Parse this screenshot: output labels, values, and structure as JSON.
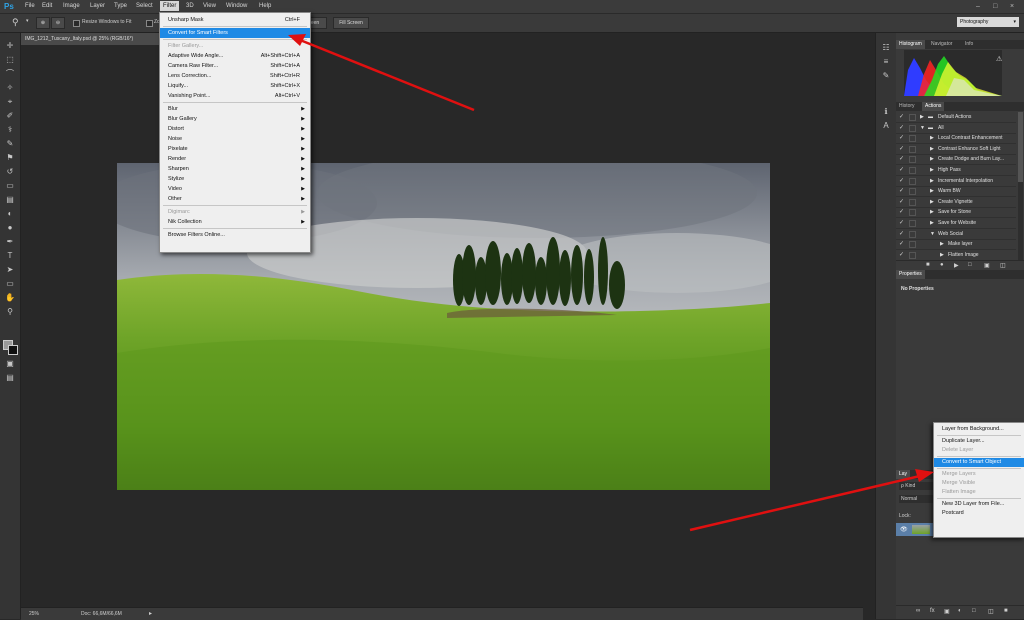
{
  "app": {
    "logo": "Ps"
  },
  "menubar": {
    "items": [
      "File",
      "Edit",
      "Image",
      "Layer",
      "Type",
      "Select",
      "Filter",
      "3D",
      "View",
      "Window",
      "Help"
    ],
    "active": "Filter"
  },
  "options": {
    "resize_label": "Resize Windows to Fit",
    "zoom_partial": "Zo",
    "fill_screen": "Fill Screen",
    "screen_partial": "een",
    "workspace": "Photography"
  },
  "document": {
    "tab_title": "IMG_1212_Tuscany_Italy.psd @ 25% (RGB/16*)",
    "zoom": "25%",
    "doc_info": "Doc: 66,6M/66,6M"
  },
  "filter_menu": [
    {
      "label": "Unsharp Mask",
      "shortcut": "Ctrl+F"
    },
    {
      "sep": true
    },
    {
      "label": "Convert for Smart Filters",
      "highlighted": true
    },
    {
      "sep": true
    },
    {
      "label": "Filter Gallery...",
      "disabled": true
    },
    {
      "label": "Adaptive Wide Angle...",
      "shortcut": "Alt+Shift+Ctrl+A"
    },
    {
      "label": "Camera Raw Filter...",
      "shortcut": "Shift+Ctrl+A"
    },
    {
      "label": "Lens Correction...",
      "shortcut": "Shift+Ctrl+R"
    },
    {
      "label": "Liquify...",
      "shortcut": "Shift+Ctrl+X"
    },
    {
      "label": "Vanishing Point...",
      "shortcut": "Alt+Ctrl+V"
    },
    {
      "sep": true
    },
    {
      "label": "Blur",
      "sub": true
    },
    {
      "label": "Blur Gallery",
      "sub": true
    },
    {
      "label": "Distort",
      "sub": true
    },
    {
      "label": "Noise",
      "sub": true
    },
    {
      "label": "Pixelate",
      "sub": true
    },
    {
      "label": "Render",
      "sub": true
    },
    {
      "label": "Sharpen",
      "sub": true
    },
    {
      "label": "Stylize",
      "sub": true
    },
    {
      "label": "Video",
      "sub": true
    },
    {
      "label": "Other",
      "sub": true
    },
    {
      "sep": true
    },
    {
      "label": "Digimarc",
      "sub": true,
      "disabled": true
    },
    {
      "label": "Nik Collection",
      "sub": true
    },
    {
      "sep": true
    },
    {
      "label": "Browse Filters Online..."
    }
  ],
  "panels": {
    "top_tabs": [
      "Histogram",
      "Navigator",
      "Info"
    ],
    "mid_tabs": [
      "History",
      "Actions"
    ],
    "properties_tab": "Properties",
    "no_properties": "No Properties",
    "layers_tab_partial": "Lay",
    "kind_partial": "ρ Kind",
    "blend_partial": "Normal",
    "lock_label": "Lock:"
  },
  "actions": [
    {
      "label": "Default Actions",
      "level": 0,
      "folder": true
    },
    {
      "label": "All",
      "level": 0,
      "folder": true,
      "open": true
    },
    {
      "label": "Local Contrast Enhancement",
      "level": 1
    },
    {
      "label": "Contrast Enhance Soft Light",
      "level": 1
    },
    {
      "label": "Create Dodge and Burn Lay...",
      "level": 1
    },
    {
      "label": "High Pass",
      "level": 1
    },
    {
      "label": "Incremental Interpolation",
      "level": 1
    },
    {
      "label": "Warm BW",
      "level": 1
    },
    {
      "label": "Create Vignette",
      "level": 1
    },
    {
      "label": "Save for Stone",
      "level": 1
    },
    {
      "label": "Save for Website",
      "level": 1
    },
    {
      "label": "Web Social",
      "level": 1,
      "open": true
    },
    {
      "label": "Make layer",
      "level": 2
    },
    {
      "label": "Flatten Image",
      "level": 2
    }
  ],
  "layer_menu": [
    {
      "label": "Layer from Background..."
    },
    {
      "sep": true
    },
    {
      "label": "Duplicate Layer..."
    },
    {
      "label": "Delete Layer",
      "disabled": true
    },
    {
      "sep": true
    },
    {
      "label": "Convert to Smart Object",
      "highlighted": true
    },
    {
      "sep": true
    },
    {
      "label": "Merge Layers",
      "disabled": true
    },
    {
      "label": "Merge Visible",
      "disabled": true
    },
    {
      "label": "Flatten Image",
      "disabled": true
    },
    {
      "sep": true
    },
    {
      "label": "New 3D Layer from File..."
    },
    {
      "label": "Postcard"
    }
  ],
  "colors": {
    "highlight": "#1f8ae5",
    "annotation_arrow": "#e01010",
    "ps_blue": "#2fa3e6"
  },
  "icons": {
    "tools": [
      "move-icon",
      "marquee-icon",
      "lasso-icon",
      "quick-select-icon",
      "crop-icon",
      "eyedropper-icon",
      "healing-icon",
      "brush-icon",
      "clone-stamp-icon",
      "history-brush-icon",
      "eraser-icon",
      "gradient-icon",
      "blur-icon",
      "dodge-icon",
      "pen-icon",
      "type-icon",
      "path-select-icon",
      "shape-icon",
      "hand-icon",
      "zoom-icon"
    ]
  }
}
